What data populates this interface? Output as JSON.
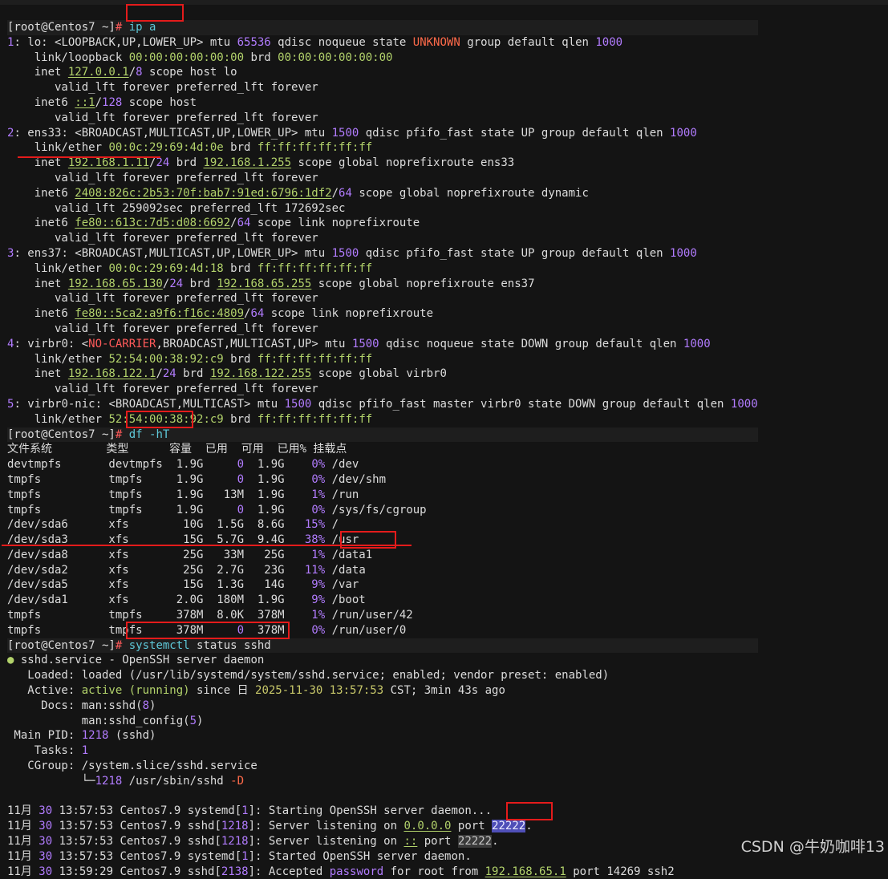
{
  "terminal": {
    "lines": [
      {
        "segs": [
          [
            "[root@Centos7 ~]",
            "0"
          ],
          [
            "#",
            "r"
          ],
          [
            " ",
            "0"
          ],
          [
            "ip a",
            "c"
          ]
        ],
        "prompt": true
      },
      {
        "segs": [
          [
            "1",
            "n"
          ],
          [
            ": lo: <LOOPBACK,UP,LOWER_UP> mtu ",
            "0"
          ],
          [
            "65536",
            "n"
          ],
          [
            " qdisc noqueue state ",
            "0"
          ],
          [
            "UNKNOWN",
            "o"
          ],
          [
            " group default qlen ",
            "0"
          ],
          [
            "1000",
            "n"
          ]
        ]
      },
      {
        "segs": [
          [
            "    link/loopback ",
            "0"
          ],
          [
            "00:00:00:00:00:00",
            "g"
          ],
          [
            " brd ",
            "0"
          ],
          [
            "00:00:00:00:00:00",
            "g"
          ]
        ]
      },
      {
        "segs": [
          [
            "    inet ",
            "0"
          ],
          [
            "127.0.0.1",
            "gu"
          ],
          [
            "/",
            "0"
          ],
          [
            "8",
            "n"
          ],
          [
            " scope host lo",
            "0"
          ]
        ]
      },
      {
        "segs": [
          [
            "       valid_lft forever preferred_lft forever",
            "0"
          ]
        ]
      },
      {
        "segs": [
          [
            "    inet6 ",
            "0"
          ],
          [
            "::1",
            "gu"
          ],
          [
            "/",
            "0"
          ],
          [
            "128",
            "n"
          ],
          [
            " scope host",
            "0"
          ]
        ]
      },
      {
        "segs": [
          [
            "       valid_lft forever preferred_lft forever",
            "0"
          ]
        ]
      },
      {
        "segs": [
          [
            "2",
            "n"
          ],
          [
            ": ens33: <BROADCAST,MULTICAST,UP,LOWER_UP> mtu ",
            "0"
          ],
          [
            "1500",
            "n"
          ],
          [
            " qdisc pfifo_fast state UP group default qlen ",
            "0"
          ],
          [
            "1000",
            "n"
          ]
        ]
      },
      {
        "segs": [
          [
            "    link/ether ",
            "0"
          ],
          [
            "00:0c:29:69:4d:0e",
            "g"
          ],
          [
            " brd ",
            "0"
          ],
          [
            "ff:ff:ff:ff:ff:ff",
            "g"
          ]
        ]
      },
      {
        "segs": [
          [
            "    inet ",
            "0"
          ],
          [
            "192.168.1.11",
            "gu"
          ],
          [
            "/",
            "0"
          ],
          [
            "24",
            "n"
          ],
          [
            " brd ",
            "0"
          ],
          [
            "192.168.1.255",
            "gu"
          ],
          [
            " scope global noprefixroute ens33",
            "0"
          ]
        ]
      },
      {
        "segs": [
          [
            "       valid_lft forever preferred_lft forever",
            "0"
          ]
        ]
      },
      {
        "segs": [
          [
            "    inet6 ",
            "0"
          ],
          [
            "2408:826c:2b53:70f:bab7:91ed:6796:1df2",
            "gu"
          ],
          [
            "/",
            "0"
          ],
          [
            "64",
            "n"
          ],
          [
            " scope global noprefixroute dynamic",
            "0"
          ]
        ]
      },
      {
        "segs": [
          [
            "       valid_lft 259092sec preferred_lft 172692sec",
            "0"
          ]
        ]
      },
      {
        "segs": [
          [
            "    inet6 ",
            "0"
          ],
          [
            "fe80::613c:7d5:d08:6692",
            "gu"
          ],
          [
            "/",
            "0"
          ],
          [
            "64",
            "n"
          ],
          [
            " scope link noprefixroute",
            "0"
          ]
        ]
      },
      {
        "segs": [
          [
            "       valid_lft forever preferred_lft forever",
            "0"
          ]
        ]
      },
      {
        "segs": [
          [
            "3",
            "n"
          ],
          [
            ": ens37: <BROADCAST,MULTICAST,UP,LOWER_UP> mtu ",
            "0"
          ],
          [
            "1500",
            "n"
          ],
          [
            " qdisc pfifo_fast state UP group default qlen ",
            "0"
          ],
          [
            "1000",
            "n"
          ]
        ]
      },
      {
        "segs": [
          [
            "    link/ether ",
            "0"
          ],
          [
            "00:0c:29:69:4d:18",
            "g"
          ],
          [
            " brd ",
            "0"
          ],
          [
            "ff:ff:ff:ff:ff:ff",
            "g"
          ]
        ]
      },
      {
        "segs": [
          [
            "    inet ",
            "0"
          ],
          [
            "192.168.65.130",
            "gu"
          ],
          [
            "/",
            "0"
          ],
          [
            "24",
            "n"
          ],
          [
            " brd ",
            "0"
          ],
          [
            "192.168.65.255",
            "gu"
          ],
          [
            " scope global noprefixroute ens37",
            "0"
          ]
        ]
      },
      {
        "segs": [
          [
            "       valid_lft forever preferred_lft forever",
            "0"
          ]
        ]
      },
      {
        "segs": [
          [
            "    inet6 ",
            "0"
          ],
          [
            "fe80::5ca2:a9f6:f16c:4809",
            "gu"
          ],
          [
            "/",
            "0"
          ],
          [
            "64",
            "n"
          ],
          [
            " scope link noprefixroute",
            "0"
          ]
        ]
      },
      {
        "segs": [
          [
            "       valid_lft forever preferred_lft forever",
            "0"
          ]
        ]
      },
      {
        "segs": [
          [
            "4",
            "n"
          ],
          [
            ": virbr0: <",
            "0"
          ],
          [
            "NO-CARRIER",
            "r"
          ],
          [
            ",BROADCAST,MULTICAST,UP> mtu ",
            "0"
          ],
          [
            "1500",
            "n"
          ],
          [
            " qdisc noqueue state DOWN group default qlen ",
            "0"
          ],
          [
            "1000",
            "n"
          ]
        ]
      },
      {
        "segs": [
          [
            "    link/ether ",
            "0"
          ],
          [
            "52:54:00:38:92:c9",
            "g"
          ],
          [
            " brd ",
            "0"
          ],
          [
            "ff:ff:ff:ff:ff:ff",
            "g"
          ]
        ]
      },
      {
        "segs": [
          [
            "    inet ",
            "0"
          ],
          [
            "192.168.122.1",
            "gu"
          ],
          [
            "/",
            "0"
          ],
          [
            "24",
            "n"
          ],
          [
            " brd ",
            "0"
          ],
          [
            "192.168.122.255",
            "gu"
          ],
          [
            " scope global virbr0",
            "0"
          ]
        ]
      },
      {
        "segs": [
          [
            "       valid_lft forever preferred_lft forever",
            "0"
          ]
        ]
      },
      {
        "segs": [
          [
            "5",
            "n"
          ],
          [
            ": virbr0-nic: <BROADCAST,MULTICAST> mtu ",
            "0"
          ],
          [
            "1500",
            "n"
          ],
          [
            " qdisc pfifo_fast master virbr0 state DOWN group default qlen ",
            "0"
          ],
          [
            "1000",
            "n"
          ]
        ]
      },
      {
        "segs": [
          [
            "    link/ether ",
            "0"
          ],
          [
            "52:54:00:38:92:c9",
            "g"
          ],
          [
            " brd ",
            "0"
          ],
          [
            "ff:ff:ff:ff:ff:ff",
            "g"
          ]
        ]
      },
      {
        "segs": [
          [
            "[root@Centos7 ~]",
            "0"
          ],
          [
            "#",
            "r"
          ],
          [
            " ",
            "0"
          ],
          [
            "df -hT",
            "c"
          ]
        ],
        "prompt": true
      },
      {
        "segs": [
          [
            "文件系统        类型      容量  已用  可用  已用% 挂载点",
            "0"
          ]
        ]
      },
      {
        "segs": [
          [
            "devtmpfs       devtmpfs  1.9G     ",
            "0"
          ],
          [
            "0",
            "n"
          ],
          [
            "  1.9G    ",
            "0"
          ],
          [
            "0%",
            "n"
          ],
          [
            " /dev",
            "0"
          ]
        ]
      },
      {
        "segs": [
          [
            "tmpfs          tmpfs     1.9G     ",
            "0"
          ],
          [
            "0",
            "n"
          ],
          [
            "  1.9G    ",
            "0"
          ],
          [
            "0%",
            "n"
          ],
          [
            " /dev/shm",
            "0"
          ]
        ]
      },
      {
        "segs": [
          [
            "tmpfs          tmpfs     1.9G   13M  1.9G    ",
            "0"
          ],
          [
            "1%",
            "n"
          ],
          [
            " /run",
            "0"
          ]
        ]
      },
      {
        "segs": [
          [
            "tmpfs          tmpfs     1.9G     ",
            "0"
          ],
          [
            "0",
            "n"
          ],
          [
            "  1.9G    ",
            "0"
          ],
          [
            "0%",
            "n"
          ],
          [
            " /sys/fs/cgroup",
            "0"
          ]
        ]
      },
      {
        "segs": [
          [
            "/dev/sda6      xfs        10G  1.5G  8.6G   ",
            "0"
          ],
          [
            "15%",
            "n"
          ],
          [
            " /",
            "0"
          ]
        ]
      },
      {
        "segs": [
          [
            "/dev/sda3      xfs        15G  5.7G  9.4G   ",
            "0"
          ],
          [
            "38%",
            "n"
          ],
          [
            " /usr",
            "0"
          ]
        ]
      },
      {
        "segs": [
          [
            "/dev/sda8      xfs        25G   33M   25G    ",
            "0"
          ],
          [
            "1%",
            "n"
          ],
          [
            " /data1",
            "0"
          ]
        ]
      },
      {
        "segs": [
          [
            "/dev/sda2      xfs        25G  2.7G   23G   ",
            "0"
          ],
          [
            "11%",
            "n"
          ],
          [
            " /data",
            "0"
          ]
        ]
      },
      {
        "segs": [
          [
            "/dev/sda5      xfs        15G  1.3G   14G    ",
            "0"
          ],
          [
            "9%",
            "n"
          ],
          [
            " /var",
            "0"
          ]
        ]
      },
      {
        "segs": [
          [
            "/dev/sda1      xfs       2.0G  180M  1.9G    ",
            "0"
          ],
          [
            "9%",
            "n"
          ],
          [
            " /boot",
            "0"
          ]
        ]
      },
      {
        "segs": [
          [
            "tmpfs          tmpfs     378M  8.0K  378M    ",
            "0"
          ],
          [
            "1%",
            "n"
          ],
          [
            " /run/user/42",
            "0"
          ]
        ]
      },
      {
        "segs": [
          [
            "tmpfs          tmpfs     378M     ",
            "0"
          ],
          [
            "0",
            "n"
          ],
          [
            "  378M    ",
            "0"
          ],
          [
            "0%",
            "n"
          ],
          [
            " /run/user/0",
            "0"
          ]
        ]
      },
      {
        "segs": [
          [
            "[root@Centos7 ~]",
            "0"
          ],
          [
            "#",
            "r"
          ],
          [
            " ",
            "0"
          ],
          [
            "systemctl",
            "c"
          ],
          [
            " status sshd",
            "0"
          ]
        ],
        "prompt": true
      },
      {
        "segs": [
          [
            "●",
            "g"
          ],
          [
            " sshd.service - OpenSSH server daemon",
            "0"
          ]
        ]
      },
      {
        "segs": [
          [
            "   Loaded: loaded (/usr/lib/systemd/system/sshd.service; enabled; vendor preset: enabled)",
            "0"
          ]
        ]
      },
      {
        "segs": [
          [
            "   Active: ",
            "0"
          ],
          [
            "active (running)",
            "g"
          ],
          [
            " since 日 ",
            "0"
          ],
          [
            "2025-11-30 13:57:53",
            "y"
          ],
          [
            " CST; 3min 43s ago",
            "0"
          ]
        ]
      },
      {
        "segs": [
          [
            "     Docs: ",
            "0"
          ],
          [
            "man:sshd",
            "0"
          ],
          [
            "(",
            "0"
          ],
          [
            "8",
            "n"
          ],
          [
            ")",
            "0"
          ]
        ]
      },
      {
        "segs": [
          [
            "           man:sshd_config",
            "0"
          ],
          [
            "(",
            "0"
          ],
          [
            "5",
            "n"
          ],
          [
            ")",
            "0"
          ]
        ]
      },
      {
        "segs": [
          [
            " Main PID: ",
            "0"
          ],
          [
            "1218",
            "n"
          ],
          [
            " (sshd)",
            "0"
          ]
        ]
      },
      {
        "segs": [
          [
            "    Tasks: ",
            "0"
          ],
          [
            "1",
            "n"
          ]
        ]
      },
      {
        "segs": [
          [
            "   CGroup: /system.slice/sshd.service",
            "0"
          ]
        ]
      },
      {
        "segs": [
          [
            "           └─",
            "0"
          ],
          [
            "1218",
            "n"
          ],
          [
            " /usr/sbin/sshd ",
            "0"
          ],
          [
            "-D",
            "o"
          ]
        ]
      },
      {
        "segs": [
          [
            " ",
            "0"
          ]
        ]
      },
      {
        "segs": [
          [
            "11月 ",
            "0"
          ],
          [
            "30",
            "n"
          ],
          [
            " 13:57:53 Centos7.9 systemd[",
            "0"
          ],
          [
            "1",
            "n"
          ],
          [
            "]: Starting OpenSSH server daemon...",
            "0"
          ]
        ]
      },
      {
        "segs": [
          [
            "11月 ",
            "0"
          ],
          [
            "30",
            "n"
          ],
          [
            " 13:57:53 Centos7.9 sshd[",
            "0"
          ],
          [
            "1218",
            "n"
          ],
          [
            "]: Server listening on ",
            "0"
          ],
          [
            "0.0.0.0",
            "gu"
          ],
          [
            " port ",
            "0"
          ],
          [
            "22222",
            "hl"
          ],
          [
            ".",
            "0"
          ]
        ]
      },
      {
        "segs": [
          [
            "11月 ",
            "0"
          ],
          [
            "30",
            "n"
          ],
          [
            " 13:57:53 Centos7.9 sshd[",
            "0"
          ],
          [
            "1218",
            "n"
          ],
          [
            "]: Server listening on ",
            "0"
          ],
          [
            "::",
            "gu"
          ],
          [
            " port ",
            "0"
          ],
          [
            "22222",
            "hl2"
          ],
          [
            ".",
            "0"
          ]
        ]
      },
      {
        "segs": [
          [
            "11月 ",
            "0"
          ],
          [
            "30",
            "n"
          ],
          [
            " 13:57:53 Centos7.9 systemd[",
            "0"
          ],
          [
            "1",
            "n"
          ],
          [
            "]: Started OpenSSH server daemon.",
            "0"
          ]
        ]
      },
      {
        "segs": [
          [
            "11月 ",
            "0"
          ],
          [
            "30",
            "n"
          ],
          [
            " 13:59:29 Centos7.9 sshd[",
            "0"
          ],
          [
            "2138",
            "n"
          ],
          [
            "]: Accepted ",
            "0"
          ],
          [
            "password",
            "p"
          ],
          [
            " for root from ",
            "0"
          ],
          [
            "192.168.65.1",
            "gu"
          ],
          [
            " port 14269 ssh2",
            "0"
          ]
        ]
      }
    ]
  },
  "watermark": "CSDN @牛奶咖啡13",
  "colors": {
    "background": "#141414",
    "text": "#dcdcdc",
    "green": "#b2d26b",
    "number": "#b27cff",
    "red": "#ff5a5a",
    "cyan": "#5ec8d8",
    "annotation": "#e41b1b"
  }
}
